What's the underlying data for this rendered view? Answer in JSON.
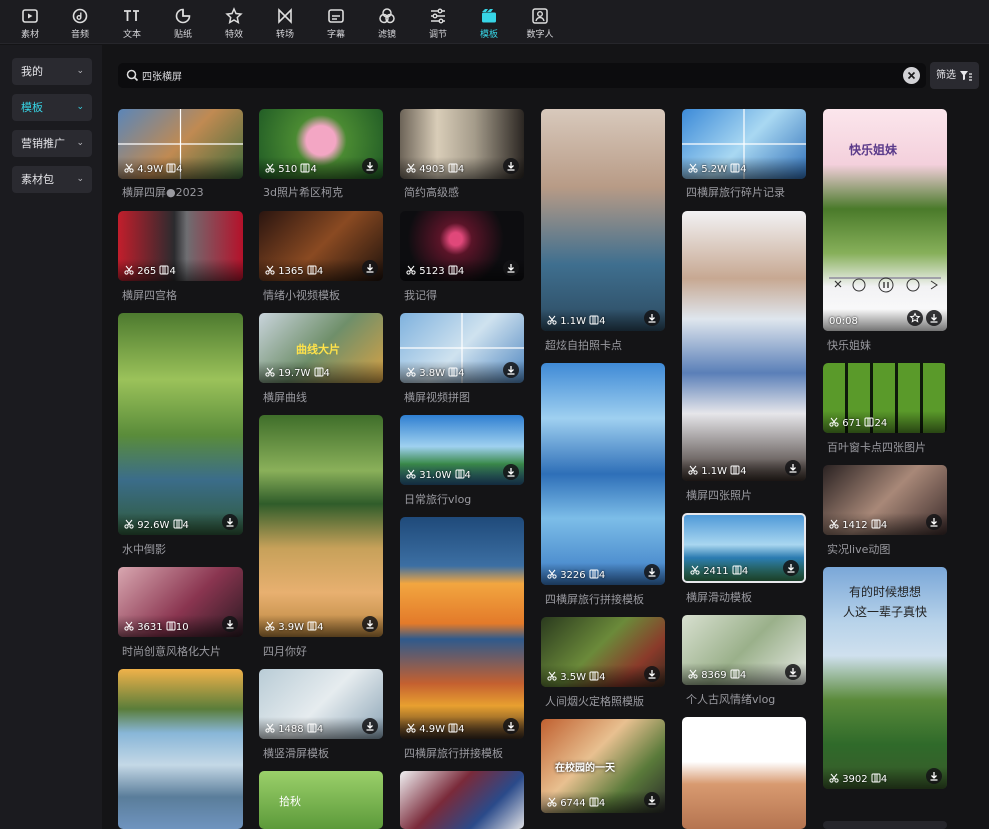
{
  "toolbar": {
    "active_index": 9,
    "active_color": "#37d5e6",
    "items": [
      {
        "label": "素材",
        "icon": "media-icon"
      },
      {
        "label": "音频",
        "icon": "audio-icon"
      },
      {
        "label": "文本",
        "icon": "text-icon"
      },
      {
        "label": "贴纸",
        "icon": "sticker-icon"
      },
      {
        "label": "特效",
        "icon": "effects-icon"
      },
      {
        "label": "转场",
        "icon": "transition-icon"
      },
      {
        "label": "字幕",
        "icon": "caption-icon"
      },
      {
        "label": "滤镜",
        "icon": "filter-icon"
      },
      {
        "label": "调节",
        "icon": "adjust-icon"
      },
      {
        "label": "模板",
        "icon": "template-icon"
      },
      {
        "label": "数字人",
        "icon": "digital-human-icon"
      }
    ]
  },
  "sidebar": {
    "items": [
      {
        "label": "我的",
        "active": false
      },
      {
        "label": "模板",
        "active": true
      },
      {
        "label": "营销推广",
        "active": false
      },
      {
        "label": "素材包",
        "active": false
      }
    ]
  },
  "search": {
    "value": "四张横屏",
    "placeholder": ""
  },
  "filter": {
    "label": "筛选"
  },
  "cards": [
    {
      "title": "横屏四屏●2023",
      "uses": "4.9W",
      "clips": "4",
      "download": false
    },
    {
      "title": "横屏四宫格",
      "uses": "265",
      "clips": "4",
      "download": false
    },
    {
      "title": "水中倒影",
      "uses": "92.6W",
      "clips": "4",
      "download": true
    },
    {
      "title": "时尚创意风格化大片",
      "uses": "3631",
      "clips": "10",
      "download": true
    },
    {
      "title": "",
      "uses": "",
      "clips": "",
      "download": false
    },
    {
      "title": "3d照片希区柯克",
      "uses": "510",
      "clips": "4",
      "download": true
    },
    {
      "title": "情绪小视频模板",
      "uses": "1365",
      "clips": "4",
      "download": true
    },
    {
      "title": "横屏曲线",
      "uses": "19.7W",
      "clips": "4",
      "download": false
    },
    {
      "title": "四月你好",
      "uses": "3.9W",
      "clips": "4",
      "download": true
    },
    {
      "title": "横竖滑屏模板",
      "uses": "1488",
      "clips": "4",
      "download": true
    },
    {
      "title": "",
      "uses": "",
      "clips": "",
      "download": false
    },
    {
      "title": "简约高级感",
      "uses": "4903",
      "clips": "4",
      "download": true
    },
    {
      "title": "我记得",
      "uses": "5123",
      "clips": "4",
      "download": true
    },
    {
      "title": "横屏视频拼图",
      "uses": "3.8W",
      "clips": "4",
      "download": true
    },
    {
      "title": "日常旅行vlog",
      "uses": "31.0W",
      "clips": "4",
      "download": true
    },
    {
      "title": "四横屏旅行拼接模板",
      "uses": "4.9W",
      "clips": "4",
      "download": true
    },
    {
      "title": "",
      "uses": "",
      "clips": "",
      "download": false
    },
    {
      "title": "超炫自拍照卡点",
      "uses": "1.1W",
      "clips": "4",
      "download": true
    },
    {
      "title": "四横屏旅行拼接模板",
      "uses": "3226",
      "clips": "4",
      "download": true
    },
    {
      "title": "人间烟火定格照模版",
      "uses": "3.5W",
      "clips": "4",
      "download": true
    },
    {
      "title": "",
      "uses": "6744",
      "clips": "4",
      "download": true
    },
    {
      "title": "四横屏旅行碎片记录",
      "uses": "5.2W",
      "clips": "4",
      "download": false
    },
    {
      "title": "横屏四张照片",
      "uses": "1.1W",
      "clips": "4",
      "download": true
    },
    {
      "title": "横屏滑动模板",
      "uses": "2411",
      "clips": "4",
      "download": true
    },
    {
      "title": "个人古风情绪vlog",
      "uses": "8369",
      "clips": "4",
      "download": true
    },
    {
      "title": "",
      "uses": "",
      "clips": "",
      "download": false
    },
    {
      "title": "快乐姐妹",
      "uses": "00:08",
      "clips": "",
      "download": true
    },
    {
      "title": "百叶窗卡点四张图片",
      "uses": "671",
      "clips": "24",
      "download": false
    },
    {
      "title": "实况live动图",
      "uses": "1412",
      "clips": "4",
      "download": true
    },
    {
      "title": "",
      "uses": "3902",
      "clips": "4",
      "download": true
    }
  ],
  "overlays": {
    "curve_text": "曲线大片",
    "poem_line1": "有的时候想想",
    "poem_line2": "人这一辈子真快",
    "campus_text": "在校园的一天",
    "leaf_text": "拾秋",
    "sister_text": "快乐姐妹"
  }
}
